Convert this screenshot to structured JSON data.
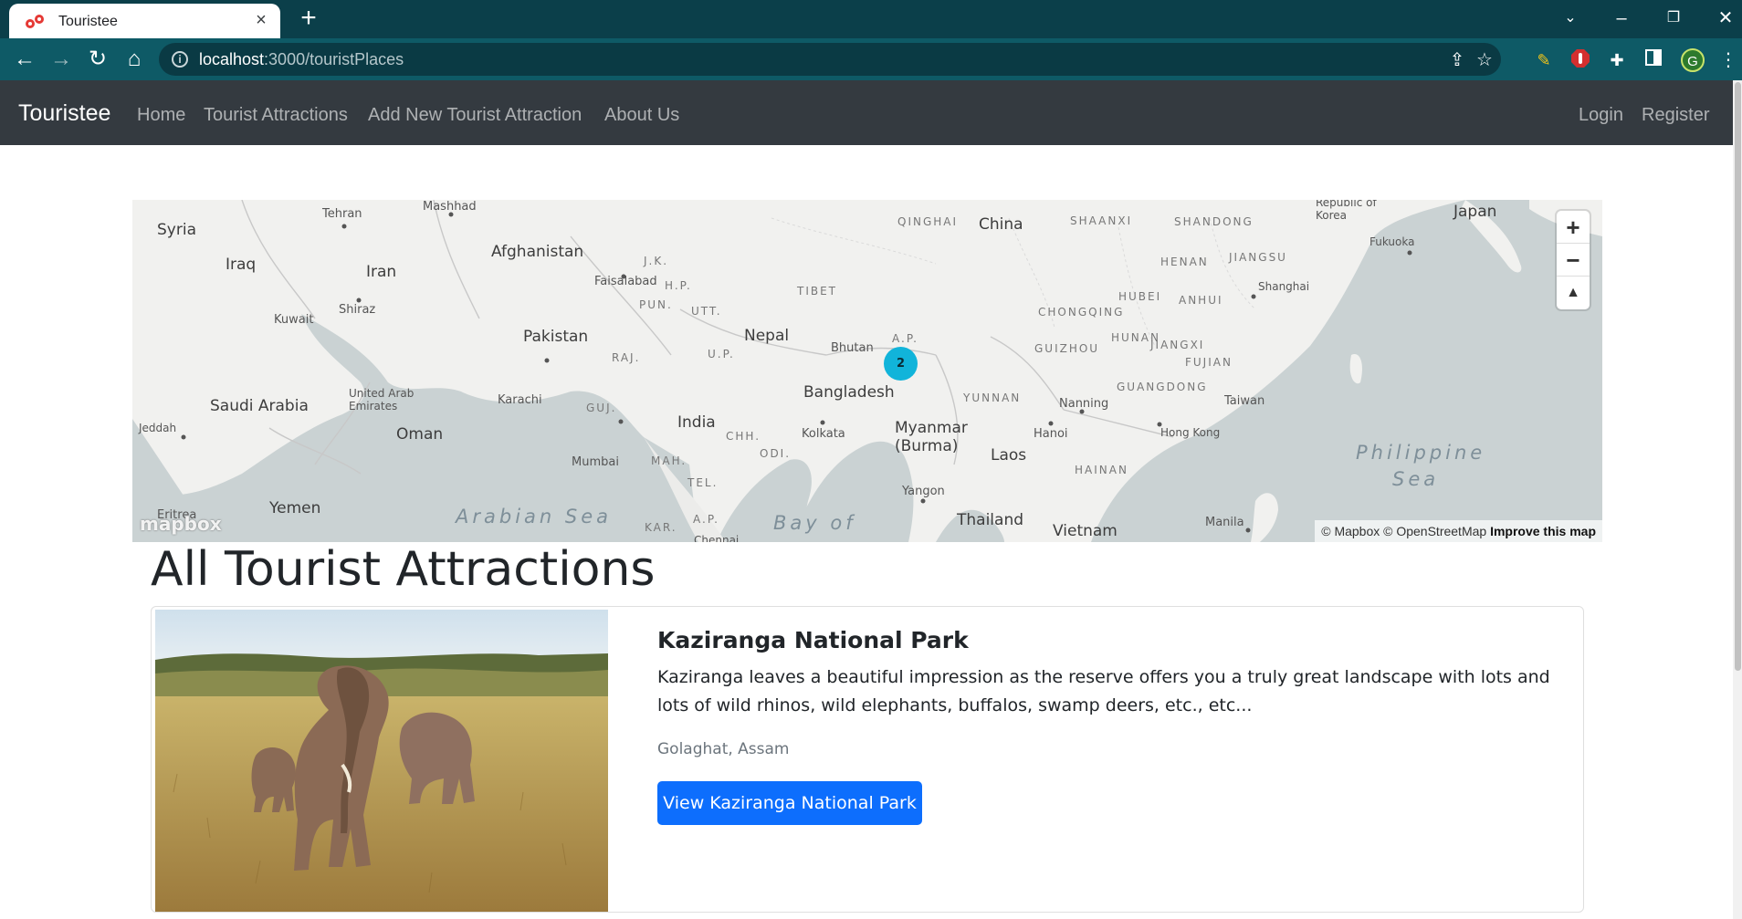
{
  "browser": {
    "tab_title": "Touristee",
    "tab_close": "×",
    "new_tab": "+",
    "url_host": "localhost",
    "url_path": ":3000/touristPlaces",
    "profile_initial": "G"
  },
  "navbar": {
    "brand": "Touristee",
    "links": [
      "Home",
      "Tourist Attractions",
      "Add New Tourist Attraction",
      "About Us"
    ],
    "login": "Login",
    "register": "Register"
  },
  "map": {
    "countries": [
      "Syria",
      "Iraq",
      "Iran",
      "Afghanistan",
      "Pakistan",
      "Saudi Arabia",
      "Oman",
      "Yemen",
      "India",
      "Nepal",
      "Bhutan",
      "Bangladesh",
      "Myanmar (Burma)",
      "Laos",
      "Thailand",
      "Vietnam",
      "China",
      "Japan",
      "Republic of Korea",
      "United Arab Emirates",
      "Kuwait",
      "Taiwan",
      "Eritrea"
    ],
    "regions": [
      "QINGHAI",
      "SHAANXI",
      "SHANDONG",
      "HENAN",
      "JIANGSU",
      "HUBEI",
      "ANHUI",
      "CHONGQING",
      "HUNAN",
      "JIANGXI",
      "GUIZHOU",
      "FUJIAN",
      "GUANGDONG",
      "YUNNAN",
      "HAINAN",
      "TIBET",
      "J.K.",
      "H.P.",
      "PUN.",
      "UTT.",
      "U.P.",
      "RAJ.",
      "GUJ.",
      "MAH.",
      "TEL.",
      "CHH.",
      "ODI.",
      "KAR.",
      "A.P.",
      "A.P."
    ],
    "cities": [
      "Tehran",
      "Mashhad",
      "Shiraz",
      "Faisalabad",
      "Karachi",
      "Mumbai",
      "Kolkata",
      "Yangon",
      "Hanoi",
      "Nanning",
      "Hong Kong",
      "Shanghai",
      "Fukuoka",
      "Jeddah",
      "Manila",
      "Chennai"
    ],
    "seas": [
      "Arabian Sea",
      "Bay of",
      "Philippine",
      "Sea"
    ],
    "cluster_count": "2",
    "zoom_in": "+",
    "zoom_out": "−",
    "compass": "▲",
    "attribution": "© Mapbox © OpenStreetMap",
    "improve": "Improve this map",
    "logo": "mapbox"
  },
  "page_title": "All Tourist Attractions",
  "card": {
    "title": "Kaziranga National Park",
    "description": "Kaziranga leaves a beautiful impression as the reserve offers you a truly great landscape with lots and lots of wild rhinos, wild elephants, buffalos, swamp deers, etc., etc...",
    "location": "Golaghat, Assam",
    "button": "View Kaziranga National Park"
  },
  "colors": {
    "navbar_bg": "#343a40",
    "primary": "#0d6efd",
    "cluster": "#11b4da",
    "water": "#cad2d3",
    "land": "#f1f1ef"
  }
}
